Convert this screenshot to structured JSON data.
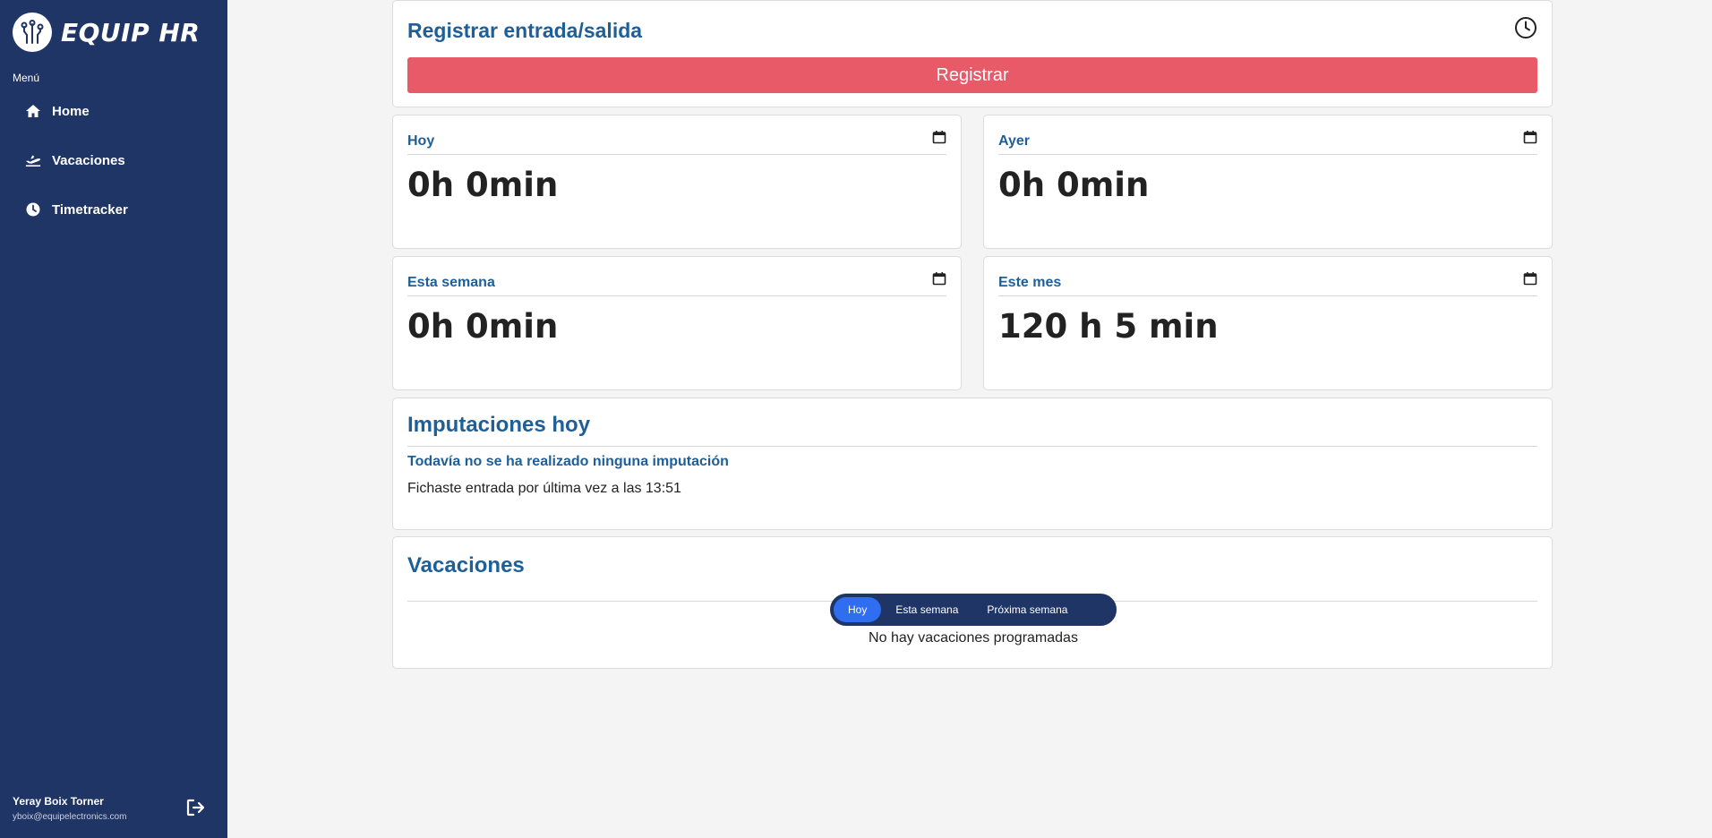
{
  "brand": {
    "name": "EQUIP HR"
  },
  "sidebar": {
    "menu_title": "Menú",
    "items": [
      {
        "label": "Home",
        "icon": "home-icon"
      },
      {
        "label": "Vacaciones",
        "icon": "plane-icon"
      },
      {
        "label": "Timetracker",
        "icon": "clock-icon"
      }
    ],
    "user": {
      "name": "Yeray Boix Torner",
      "email": "yboix@equipelectronics.com"
    }
  },
  "register": {
    "title": "Registrar entrada/salida",
    "button_label": "Registrar"
  },
  "stats": {
    "hoy": {
      "label": "Hoy",
      "value": "0h 0min"
    },
    "ayer": {
      "label": "Ayer",
      "value": "0h 0min"
    },
    "semana": {
      "label": "Esta semana",
      "value": "0h 0min"
    },
    "mes": {
      "label": "Este mes",
      "value": "120 h 5 min"
    }
  },
  "imputaciones": {
    "title": "Imputaciones hoy",
    "empty_message": "Todavía no se ha realizado ninguna imputación",
    "last_entry": "Fichaste entrada por última vez a las 13:51"
  },
  "vacaciones": {
    "title": "Vacaciones",
    "tabs": [
      "Hoy",
      "Esta semana",
      "Próxima semana"
    ],
    "active_tab": "Hoy",
    "empty_message": "No hay vacaciones programadas"
  },
  "colors": {
    "sidebar_bg": "#1f3566",
    "heading": "#1e5f98",
    "register_button": "#e85a68",
    "active_tab": "#2f6ef0"
  }
}
